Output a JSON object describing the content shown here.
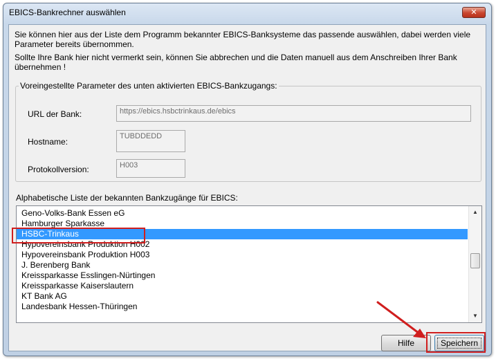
{
  "window": {
    "title": "EBICS-Bankrechner auswählen",
    "close_glyph": "✕"
  },
  "intro": {
    "text1": "Sie können hier aus der Liste dem Programm bekannter EBICS-Banksysteme das passende auswählen, dabei werden viele Parameter bereits übernommen.",
    "text2": "Sollte Ihre Bank hier nicht vermerkt sein, können Sie abbrechen und die Daten manuell aus dem Anschreiben Ihrer Bank übernehmen !"
  },
  "params": {
    "legend": "Voreingestellte Parameter des unten aktivierten EBICS-Bankzugangs:",
    "url_label": "URL der Bank:",
    "url_value": "https://ebics.hsbctrinkaus.de/ebics",
    "host_label": "Hostname:",
    "host_value": "TUBDDEDD",
    "protocol_label": "Protokollversion:",
    "protocol_value": "H003"
  },
  "banklist": {
    "label": "Alphabetische Liste der bekannten Bankzugänge für EBICS:",
    "items": [
      "Geno-Volks-Bank Essen eG",
      "Hamburger Sparkasse",
      "HSBC-Trinkaus",
      "Hypovereinsbank Produktion H002",
      "Hypovereinsbank Produktion H003",
      "J. Berenberg Bank",
      "Kreissparkasse Esslingen-Nürtingen",
      "Kreissparkasse Kaiserslautern",
      "KT Bank AG",
      "Landesbank Hessen-Thüringen"
    ],
    "selected_index": 2,
    "scroll_up_glyph": "▲",
    "scroll_down_glyph": "▼"
  },
  "buttons": {
    "help": "Hilfe",
    "save": "Speichern"
  },
  "colors": {
    "selection": "#3399ff",
    "annotation": "#d01e1e"
  }
}
